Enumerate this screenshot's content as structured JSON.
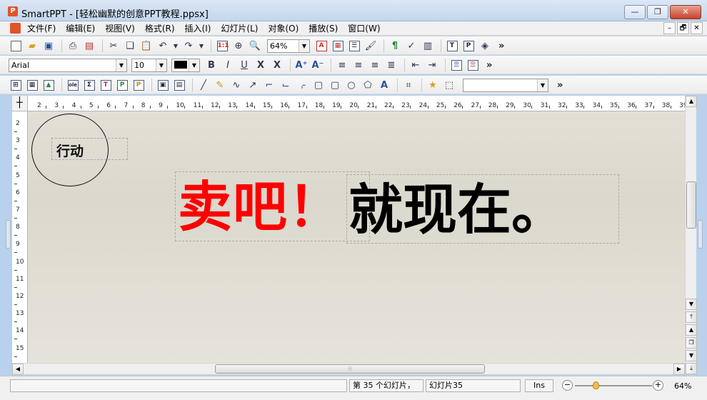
{
  "window": {
    "title": "SmartPPT - [轻松幽默的创意PPT教程.ppsx]",
    "app_icon_letter": "P",
    "minimize_glyph": "—",
    "restore_glyph": "❐",
    "close_glyph": "✕"
  },
  "menu": {
    "items": [
      "文件(F)",
      "编辑(E)",
      "视图(V)",
      "格式(R)",
      "插入(I)",
      "幻灯片(L)",
      "对象(O)",
      "播放(S)",
      "窗口(W)"
    ],
    "mdi": [
      "–",
      "🗗",
      "✕"
    ]
  },
  "toolbar1": {
    "zoom_value": "64%",
    "more": "»"
  },
  "toolbar2": {
    "font_name": "Arial",
    "font_size": "10",
    "more": "»"
  },
  "toolbar3": {
    "style_value": "",
    "more": "»"
  },
  "ruler": {
    "h_labels": [
      "2",
      "3",
      "4",
      "5",
      "6",
      "7",
      "8",
      "9",
      "10",
      "11",
      "12",
      "13",
      "14",
      "15",
      "16",
      "17",
      "18",
      "19",
      "20",
      "21",
      "22",
      "23",
      "24",
      "25",
      "26",
      "27",
      "28",
      "29",
      "30",
      "31",
      "32",
      "33",
      "34",
      "35",
      "36",
      "37",
      "38",
      "39"
    ],
    "v_labels": [
      "2",
      "3",
      "4",
      "5",
      "6",
      "7",
      "8",
      "9",
      "10",
      "11",
      "12",
      "13",
      "14",
      "15"
    ]
  },
  "slide": {
    "circle_label": "行动",
    "red_text": "卖吧！",
    "black_text": "就现在。"
  },
  "statusbar": {
    "slide_count": "第 35 个幻灯片，",
    "current_slide": "幻灯片35",
    "mode": "Ins",
    "zoom": "64%",
    "zoom_minus": "−",
    "zoom_plus": "+"
  },
  "colors": {
    "accent_red": "#ff0000",
    "title_bar": "#c4d6ec"
  }
}
